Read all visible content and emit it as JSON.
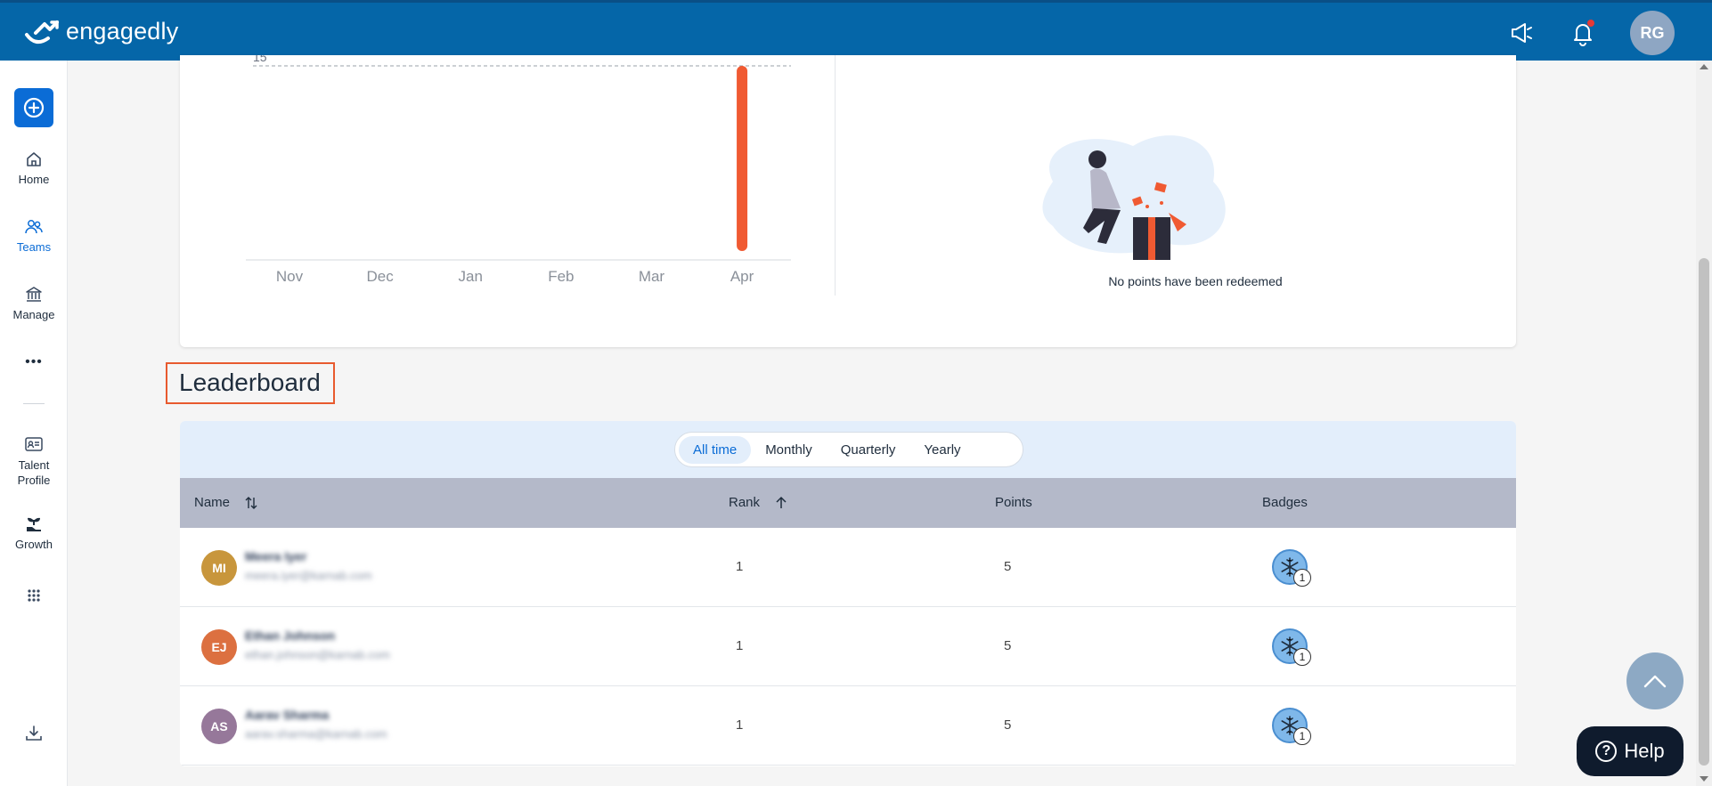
{
  "app": {
    "name": "engagedly",
    "user_initials": "RG"
  },
  "sidebar": {
    "items": [
      {
        "label": "Home"
      },
      {
        "label": "Teams"
      },
      {
        "label": "Manage"
      },
      {
        "label": "Talent Profile"
      },
      {
        "label": "Growth"
      }
    ]
  },
  "chart_data": {
    "type": "bar",
    "categories": [
      "Nov",
      "Dec",
      "Jan",
      "Feb",
      "Mar",
      "Apr"
    ],
    "values": [
      0,
      0,
      0,
      0,
      0,
      15
    ],
    "ylim": [
      0,
      15
    ],
    "yticks": [
      15
    ],
    "title": "",
    "xlabel": "",
    "ylabel": "",
    "bar_color": "#f05a32",
    "grid": "dashed at 15"
  },
  "redemption": {
    "empty_text": "No points have been redeemed"
  },
  "leaderboard": {
    "title": "Leaderboard",
    "tabs": [
      "All time",
      "Monthly",
      "Quarterly",
      "Yearly"
    ],
    "active_tab": "All time",
    "columns": {
      "name": "Name",
      "rank": "Rank",
      "points": "Points",
      "badges": "Badges"
    },
    "rows": [
      {
        "initials": "MI",
        "name": "Meera Iyer",
        "email": "meera.iyer@karnab.com",
        "rank": "1",
        "points": "5",
        "badge_count": "1",
        "avatar_color": "#c8963c"
      },
      {
        "initials": "EJ",
        "name": "Ethan Johnson",
        "email": "ethan.johnson@karnab.com",
        "rank": "1",
        "points": "5",
        "badge_count": "1",
        "avatar_color": "#dc7040"
      },
      {
        "initials": "AS",
        "name": "Aarav Sharma",
        "email": "aarav.sharma@karnab.com",
        "rank": "1",
        "points": "5",
        "badge_count": "1",
        "avatar_color": "#96789a"
      }
    ]
  },
  "help": {
    "label": "Help"
  },
  "colors": {
    "brand_blue": "#0566a8",
    "accent": "#0b6cd6",
    "highlight_border": "#e85a2e"
  }
}
